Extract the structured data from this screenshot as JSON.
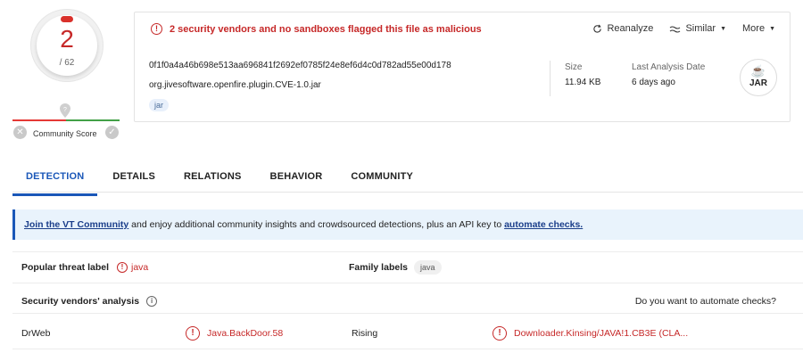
{
  "score": {
    "detections": "2",
    "total": "/ 62"
  },
  "community": {
    "label": "Community Score"
  },
  "alert": {
    "text": "2 security vendors and no sandboxes flagged this file as malicious"
  },
  "actions": [
    {
      "label": "Reanalyze",
      "icon": "refresh-icon"
    },
    {
      "label": "Similar",
      "icon": "similar-icon"
    },
    {
      "label": "More",
      "icon": "chevron-down-icon"
    }
  ],
  "file": {
    "hash": "0f1f0a4a46b698e513aa696841f2692ef0785f24e8ef6d4c0d782ad55e00d178",
    "name": "org.jivesoftware.openfire.plugin.CVE-1.0.jar",
    "tag": "jar",
    "size_label": "Size",
    "size": "11.94 KB",
    "last_label": "Last Analysis Date",
    "last": "6 days ago",
    "type": "JAR"
  },
  "tabs": [
    "DETECTION",
    "DETAILS",
    "RELATIONS",
    "BEHAVIOR",
    "COMMUNITY"
  ],
  "banner": {
    "link1": "Join the VT Community",
    "mid": " and enjoy additional community insights and crowdsourced detections, plus an API key to ",
    "link2": "automate checks."
  },
  "labels": {
    "popular_label": "Popular threat label",
    "popular_value": "java",
    "family_label": "Family labels",
    "family_value": "java"
  },
  "vendors": {
    "title": "Security vendors' analysis",
    "automate": "Do you want to automate checks?",
    "rows": [
      {
        "vendor": "DrWeb",
        "result": "Java.BackDoor.58",
        "vendor2": "Rising",
        "result2": "Downloader.Kinsing/JAVA!1.CB3E (CLA..."
      }
    ]
  },
  "colors": {
    "danger": "#c62828",
    "accent": "#1a57b8"
  }
}
